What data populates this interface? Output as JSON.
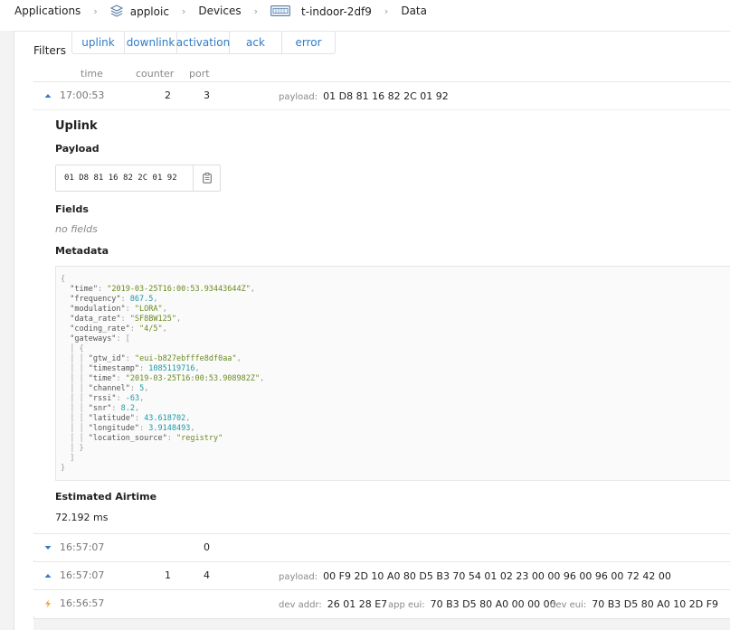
{
  "breadcrumb": {
    "applications": "Applications",
    "app": "apploic",
    "devices": "Devices",
    "device": "t-indoor-2df9",
    "page": "Data",
    "separator": "›"
  },
  "filters": {
    "label": "Filters",
    "tabs": [
      "uplink",
      "downlink",
      "activation",
      "ack",
      "error"
    ]
  },
  "columns": {
    "time": "time",
    "counter": "counter",
    "port": "port"
  },
  "rows": [
    {
      "kind": "uplink-up",
      "time": "17:00:53",
      "counter": "2",
      "port": "3",
      "payload_label": "payload:",
      "payload": "01 D8 81 16 82 2C 01 92"
    },
    {
      "kind": "downlink",
      "time": "16:57:07",
      "counter": "",
      "port": "0"
    },
    {
      "kind": "uplink-up",
      "time": "16:57:07",
      "counter": "1",
      "port": "4",
      "payload_label": "payload:",
      "payload": "00 F9 2D 10 A0 80 D5 B3 70 54 01 02 23 00 00 96 00 96 00 72 42 00"
    },
    {
      "kind": "activation",
      "time": "16:56:57",
      "dev_addr_label": "dev addr:",
      "dev_addr": "26 01 28 E7",
      "app_eui_label": "app eui:",
      "app_eui": "70 B3 D5 80 A0 00 00 00",
      "dev_eui_label": "dev eui:",
      "dev_eui": "70 B3 D5 80 A0 10 2D F9"
    }
  ],
  "detail": {
    "title": "Uplink",
    "payload_heading": "Payload",
    "payload_hex": "01 D8 81 16 82 2C 01 92",
    "fields_heading": "Fields",
    "no_fields": "no fields",
    "metadata_heading": "Metadata",
    "metadata": {
      "time": "2019-03-25T16:00:53.93443644Z",
      "frequency": "867.5",
      "modulation": "LORA",
      "data_rate": "SF8BW125",
      "coding_rate": "4/5",
      "gateway": {
        "gtw_id": "eui-b827ebfffe8df0aa",
        "timestamp": "1085119716",
        "time": "2019-03-25T16:00:53.908982Z",
        "channel": "5",
        "rssi": "-63",
        "snr": "8.2",
        "latitude": "43.618702",
        "longitude": "3.9148493",
        "location_source": "registry"
      }
    },
    "airtime_heading": "Estimated Airtime",
    "airtime": "72.192 ms"
  },
  "colors": {
    "accent": "#2f7cc8",
    "activation": "#f5a623"
  }
}
